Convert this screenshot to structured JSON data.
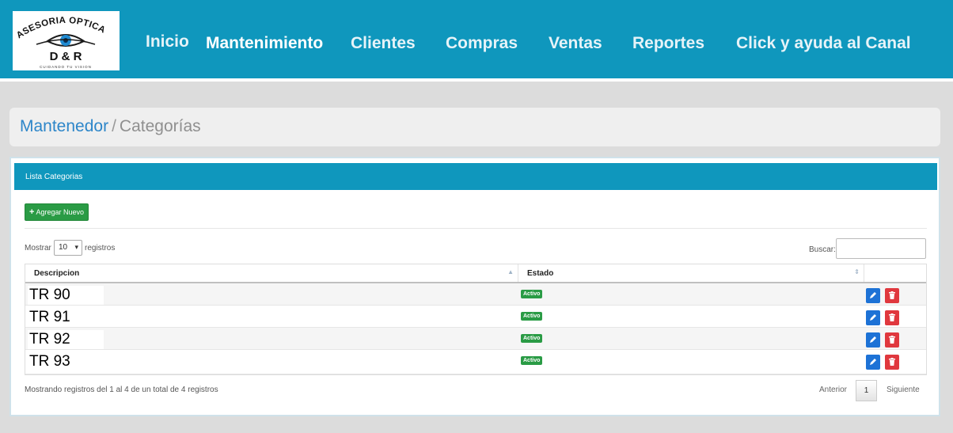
{
  "logo": {
    "arc_text": "ASESORIA OPTICA",
    "brand": "D & R",
    "tagline": "CUIDANDO TU VISION"
  },
  "nav": {
    "items": [
      {
        "label": "Inicio"
      },
      {
        "label": "Mantenimiento"
      },
      {
        "label": "Clientes"
      },
      {
        "label": "Compras"
      },
      {
        "label": "Ventas"
      },
      {
        "label": "Reportes"
      },
      {
        "label": "Click y ayuda al Canal"
      }
    ],
    "active": "Mantenimiento"
  },
  "breadcrumb": {
    "parent": "Mantenedor",
    "separator": "/",
    "current": "Categorías"
  },
  "panel": {
    "title": "Lista Categorias",
    "add_button": "Agregar Nuevo",
    "show_label": "Mostrar",
    "page_size": "10",
    "records_label": "registros",
    "search_label": "Buscar:",
    "search_value": ""
  },
  "table": {
    "columns": [
      "Descripcion",
      "Estado",
      ""
    ],
    "rows": [
      {
        "descripcion": "TR 90",
        "estado": "Activo"
      },
      {
        "descripcion": "TR 91",
        "estado": "Activo"
      },
      {
        "descripcion": "TR 92",
        "estado": "Activo"
      },
      {
        "descripcion": "TR 93",
        "estado": "Activo"
      }
    ]
  },
  "footer": {
    "info": "Mostrando registros del 1 al 4 de un total de 4 registros",
    "prev": "Anterior",
    "page": "1",
    "next": "Siguiente"
  },
  "colors": {
    "header": "#0f97bd",
    "link": "#2d86c9",
    "success": "#2a9b45",
    "edit": "#1d72d6",
    "delete": "#e0383e"
  },
  "icons": {
    "add": "plus-icon",
    "edit": "pencil-icon",
    "delete": "trash-icon",
    "sort": "sort-icon",
    "select": "chevron-down-icon",
    "logo": "eye-icon"
  }
}
